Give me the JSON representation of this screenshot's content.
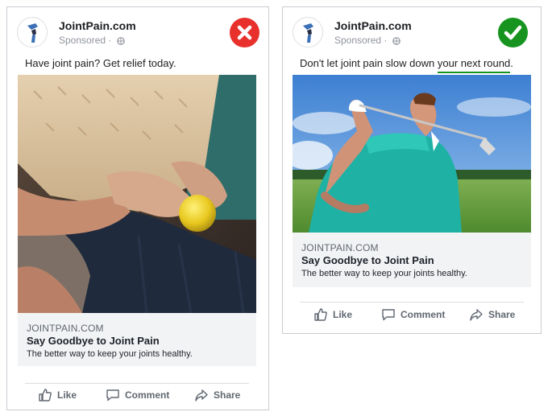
{
  "colors": {
    "wrong": "#e8312c",
    "right": "#16941f",
    "highlight_underline": "#16941f",
    "link_box_bg": "#f2f3f5"
  },
  "ads": {
    "left": {
      "page_name": "JointPain.com",
      "sponsored": "Sponsored ·",
      "verdict_icon": "x-icon",
      "caption": "Have joint pain? Get relief today.",
      "image_subject": "elderly hands holding a yellow ball",
      "link_domain": "JOINTPAIN.COM",
      "link_title": "Say Goodbye to Joint Pain",
      "link_desc": "The better way to keep your joints healthy.",
      "actions": {
        "like": "Like",
        "comment": "Comment",
        "share": "Share"
      }
    },
    "right": {
      "page_name": "JointPain.com",
      "sponsored": "Sponsored ·",
      "verdict_icon": "checkmark-icon",
      "caption_prefix": "Don't let joint pain slow down ",
      "caption_highlight": "your next round",
      "caption_suffix": ".",
      "image_subject": "man swinging a golf club",
      "link_domain": "JOINTPAIN.COM",
      "link_title": "Say Goodbye to Joint Pain",
      "link_desc": "The better way to keep your joints healthy.",
      "actions": {
        "like": "Like",
        "comment": "Comment",
        "share": "Share"
      }
    }
  }
}
